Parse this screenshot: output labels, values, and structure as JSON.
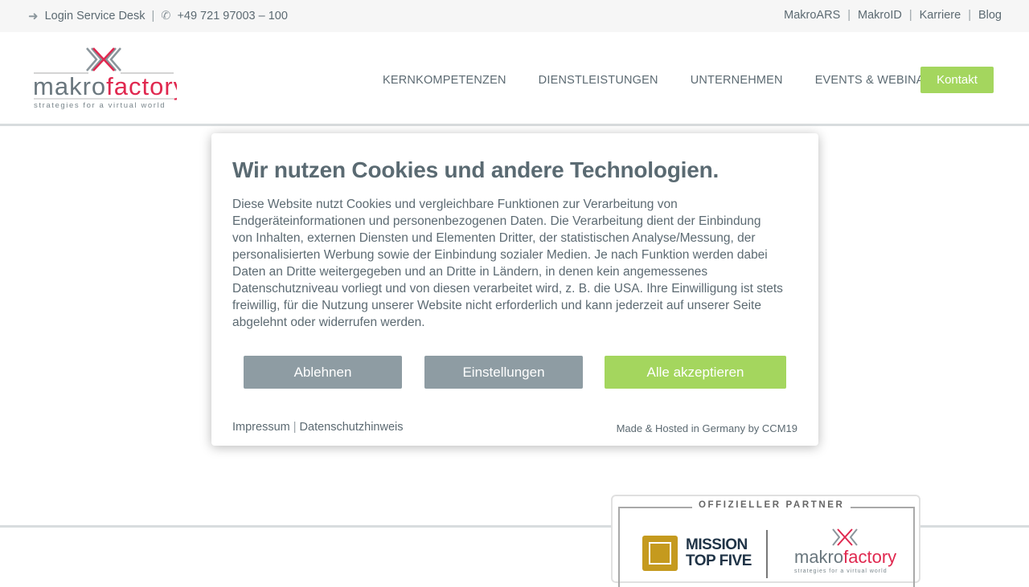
{
  "topbar": {
    "login": "Login Service Desk",
    "phone": "+49 721 97003 – 100",
    "links": [
      "MakroARS",
      "MakroID",
      "Karriere",
      "Blog"
    ]
  },
  "header": {
    "logo_alt": "makrofactory strategies for a virtual world",
    "logo_word_a": "makro",
    "logo_word_b": "factory",
    "logo_tagline": "strategies for a virtual world",
    "nav": [
      "KERNKOMPETENZEN",
      "DIENSTLEISTUNGEN",
      "UNTERNEHMEN",
      "EVENTS & WEBINARE"
    ],
    "contact": "Kontakt"
  },
  "colors": {
    "accent": "#a4d65e",
    "button_gray": "#8e9ca3",
    "text": "#5c6a72",
    "logo_red": "#e0284f"
  },
  "cookie": {
    "title": "Wir nutzen Cookies und andere Technologien.",
    "body_lines": [
      "Diese Website nutzt Cookies und vergleichbare Funktionen zur Verarbeitung von",
      "Endgeräteinformationen und personenbezogenen Daten. Die Verarbeitung dient der Einbindung",
      "von Inhalten, externen Diensten und Elementen Dritter, der statistischen Analyse/Messung, der",
      "personalisierten Werbung sowie der Einbindung sozialer Medien. Je nach Funktion werden dabei",
      "Daten an Dritte weitergegeben und an Dritte in Ländern, in denen kein angemessenes",
      "Datenschutzniveau vorliegt und von diesen verarbeitet wird, z. B. die USA. Ihre Einwilligung ist stets",
      "freiwillig, für die Nutzung unserer Website nicht erforderlich und kann jederzeit auf unserer Seite",
      "abgelehnt oder widerrufen werden."
    ],
    "reject": "Ablehnen",
    "settings": "Einstellungen",
    "accept": "Alle akzeptieren",
    "imprint": "Impressum",
    "privacy": "Datenschutzhinweis",
    "made_by": "Made & Hosted in Germany by CCM19"
  },
  "partner": {
    "title": "OFFIZIELLER PARTNER",
    "mission_line1": "MISSION",
    "mission_line2": "TOP FIVE",
    "logo_word_a": "makro",
    "logo_word_b": "factory",
    "logo_tagline": "strategies for a virtual world"
  }
}
